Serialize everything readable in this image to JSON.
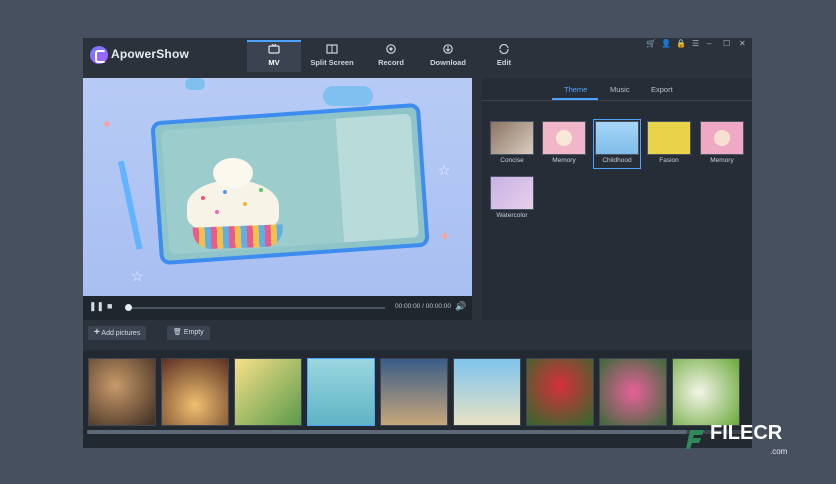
{
  "app": {
    "title": "ApowerShow"
  },
  "nav": {
    "tabs": [
      {
        "label": "MV",
        "icon": "mv-icon",
        "active": true
      },
      {
        "label": "Split Screen",
        "icon": "split-screen-icon",
        "active": false
      },
      {
        "label": "Record",
        "icon": "record-icon",
        "active": false
      },
      {
        "label": "Download",
        "icon": "download-icon",
        "active": false
      },
      {
        "label": "Edit",
        "icon": "edit-icon",
        "active": false
      }
    ]
  },
  "window_controls": [
    {
      "icon": "cart-icon",
      "glyph": "🛒"
    },
    {
      "icon": "user-icon",
      "glyph": "👤"
    },
    {
      "icon": "lock-icon",
      "glyph": "🔒"
    },
    {
      "icon": "menu-icon",
      "glyph": "☰"
    },
    {
      "icon": "minimize-icon",
      "glyph": "–"
    },
    {
      "icon": "maximize-icon",
      "glyph": "☐"
    },
    {
      "icon": "close-icon",
      "glyph": "✕"
    }
  ],
  "player": {
    "time": "00:00:00 / 00:00:00",
    "progress": 0
  },
  "panel": {
    "tabs": [
      "Theme",
      "Music",
      "Export"
    ],
    "active_tab": "Theme",
    "themes": [
      {
        "label": "Concise",
        "selected": false,
        "color": "#7d6a5a"
      },
      {
        "label": "Memory",
        "selected": false,
        "color": "#f1b7c8"
      },
      {
        "label": "Childhood",
        "selected": true,
        "color": "#8ec9f2"
      },
      {
        "label": "Fasion",
        "selected": false,
        "color": "#e9d34a"
      },
      {
        "label": "Memory",
        "selected": false,
        "color": "#f0a9c4"
      },
      {
        "label": "Watercolor",
        "selected": false,
        "color": "#b9a5d8"
      }
    ]
  },
  "toolbar": {
    "add_pictures": "Add pictures",
    "empty": "Empty"
  },
  "pictures": [
    {
      "color": "#5e4a3a",
      "selected": false
    },
    {
      "color": "#6a3d2c",
      "selected": false
    },
    {
      "color": "#d9b44a",
      "selected": false
    },
    {
      "color": "#7ec2cf",
      "selected": true
    },
    {
      "color": "#3c5f85",
      "selected": false
    },
    {
      "color": "#8ec9e6",
      "selected": false
    },
    {
      "color": "#3e8a3c",
      "selected": false
    },
    {
      "color": "#d86a9c",
      "selected": false
    },
    {
      "color": "#9cc55a",
      "selected": false
    }
  ],
  "watermark": {
    "text": "FILECR",
    "sub": ".com"
  }
}
